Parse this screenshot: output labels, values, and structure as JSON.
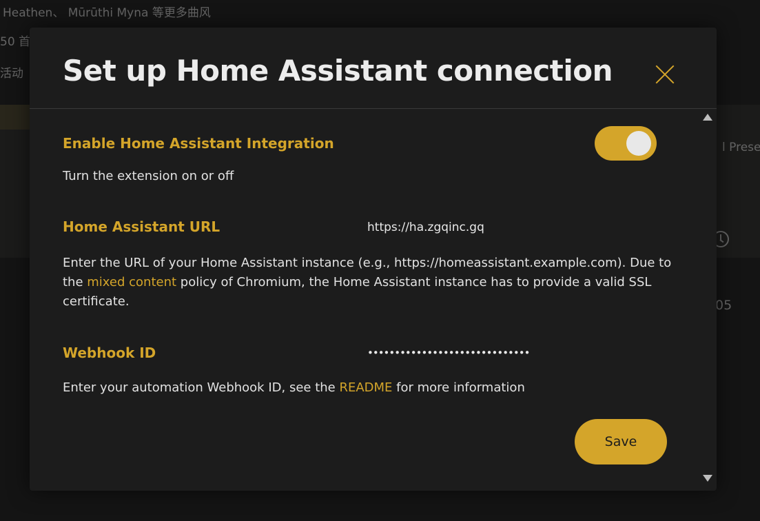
{
  "background": {
    "line1": "Heathen、 Mūrūthi Myna 等更多曲风",
    "line2": "50 首",
    "line3": "活动",
    "preset_fragment": "l Prese",
    "number_fragment": "05",
    "clock_icon": "clock-icon"
  },
  "modal": {
    "title": "Set up Home Assistant connection",
    "close_icon": "close-icon",
    "enable": {
      "label": "Enable Home Assistant Integration",
      "description": "Turn the extension on or off",
      "toggle_on": true
    },
    "url": {
      "label": "Home Assistant URL",
      "value": "https://ha.zgqinc.gq",
      "description_part1": "Enter the URL of your Home Assistant instance (e.g., https://homeassistant.example.com). Due to the ",
      "description_link": "mixed content",
      "description_part2": " policy of Chromium, the Home Assistant instance has to provide a valid SSL certificate."
    },
    "webhook": {
      "label": "Webhook ID",
      "value": "••••••••••••••••••••••••••••••",
      "description_part1": "Enter your automation Webhook ID, see the ",
      "description_link": "README",
      "description_part2": " for more information"
    },
    "save_label": "Save"
  },
  "colors": {
    "accent": "#d4a52a",
    "background": "#1c1c1c",
    "text": "#e6e6e6"
  }
}
